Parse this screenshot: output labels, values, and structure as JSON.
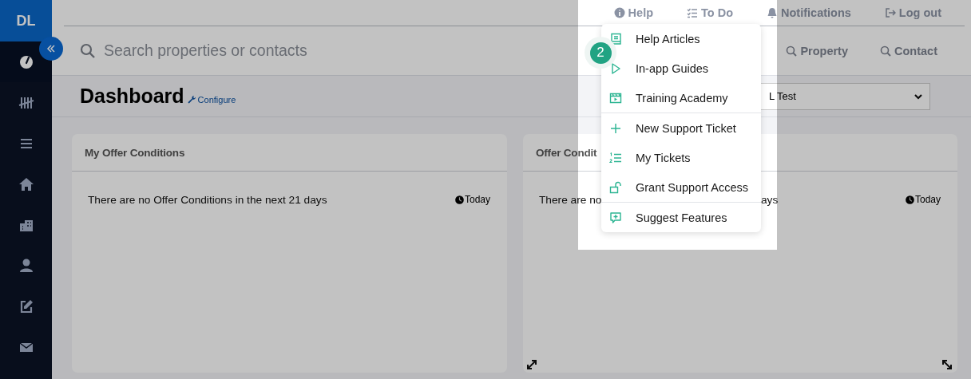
{
  "sidebar": {
    "avatar": "DL",
    "items": [
      {
        "selected": true
      },
      {
        "selected": false
      },
      {
        "selected": false
      },
      {
        "selected": false
      },
      {
        "selected": false
      },
      {
        "selected": false
      },
      {
        "selected": false
      },
      {
        "selected": false
      }
    ]
  },
  "top_nav": [
    {
      "label": "Help"
    },
    {
      "label": "To Do"
    },
    {
      "label": "Notifications"
    },
    {
      "label": "Log out"
    }
  ],
  "search": {
    "placeholder": "Search properties or contacts"
  },
  "quick_search": [
    "Property",
    "Contact"
  ],
  "header": {
    "title": "Dashboard",
    "link": "Configure",
    "select_value": "L Test"
  },
  "cards": [
    {
      "title": "My Offer Conditions",
      "message": "There are no Offer Conditions in the next 21 days",
      "date_filter": "Today",
      "expand_controls": false
    },
    {
      "title": "Offer Condit",
      "message": "There are no",
      "message_end": "ays",
      "date_filter": "Today",
      "expand_controls": true
    }
  ],
  "tour_step": "2",
  "help_menu": {
    "groups": [
      [
        "Help Articles",
        "In-app Guides",
        "Training Academy"
      ],
      [
        "New Support Ticket",
        "My Tickets",
        "Grant Support Access"
      ],
      [
        "Suggest Features"
      ]
    ]
  }
}
